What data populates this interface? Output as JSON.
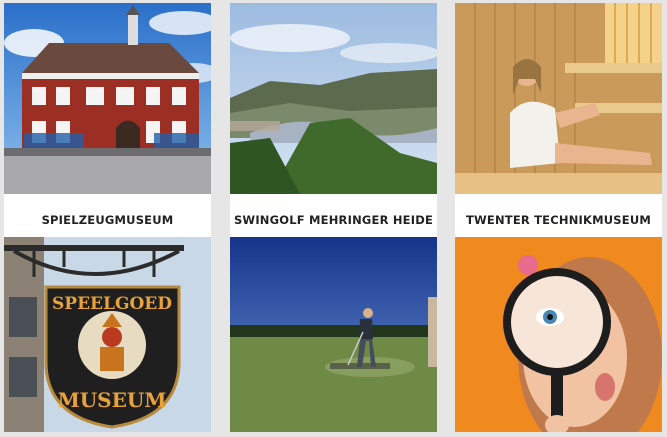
{
  "tiles": [
    {
      "label": "SPIELZEUGMUSEUM",
      "image": "red-brick-museum-building"
    },
    {
      "label": "SWINGOLF MEHRINGER HEIDE",
      "image": "mosel-valley-landscape"
    },
    {
      "label": "TWENTER TECHNIKMUSEUM",
      "image": "woman-in-sauna"
    },
    {
      "label": "",
      "image": "speelgoed-museum-sign"
    },
    {
      "label": "",
      "image": "man-playing-swingolf"
    },
    {
      "label": "",
      "image": "girl-with-magnifying-glass"
    }
  ],
  "signs": {
    "top": "SPEELGOED",
    "bottom": "MUSEUM"
  },
  "colors": {
    "label_bg": "#ffffff",
    "label_text": "#222222",
    "page_bg": "#e6e6e6",
    "orange": "#f08a1e"
  }
}
